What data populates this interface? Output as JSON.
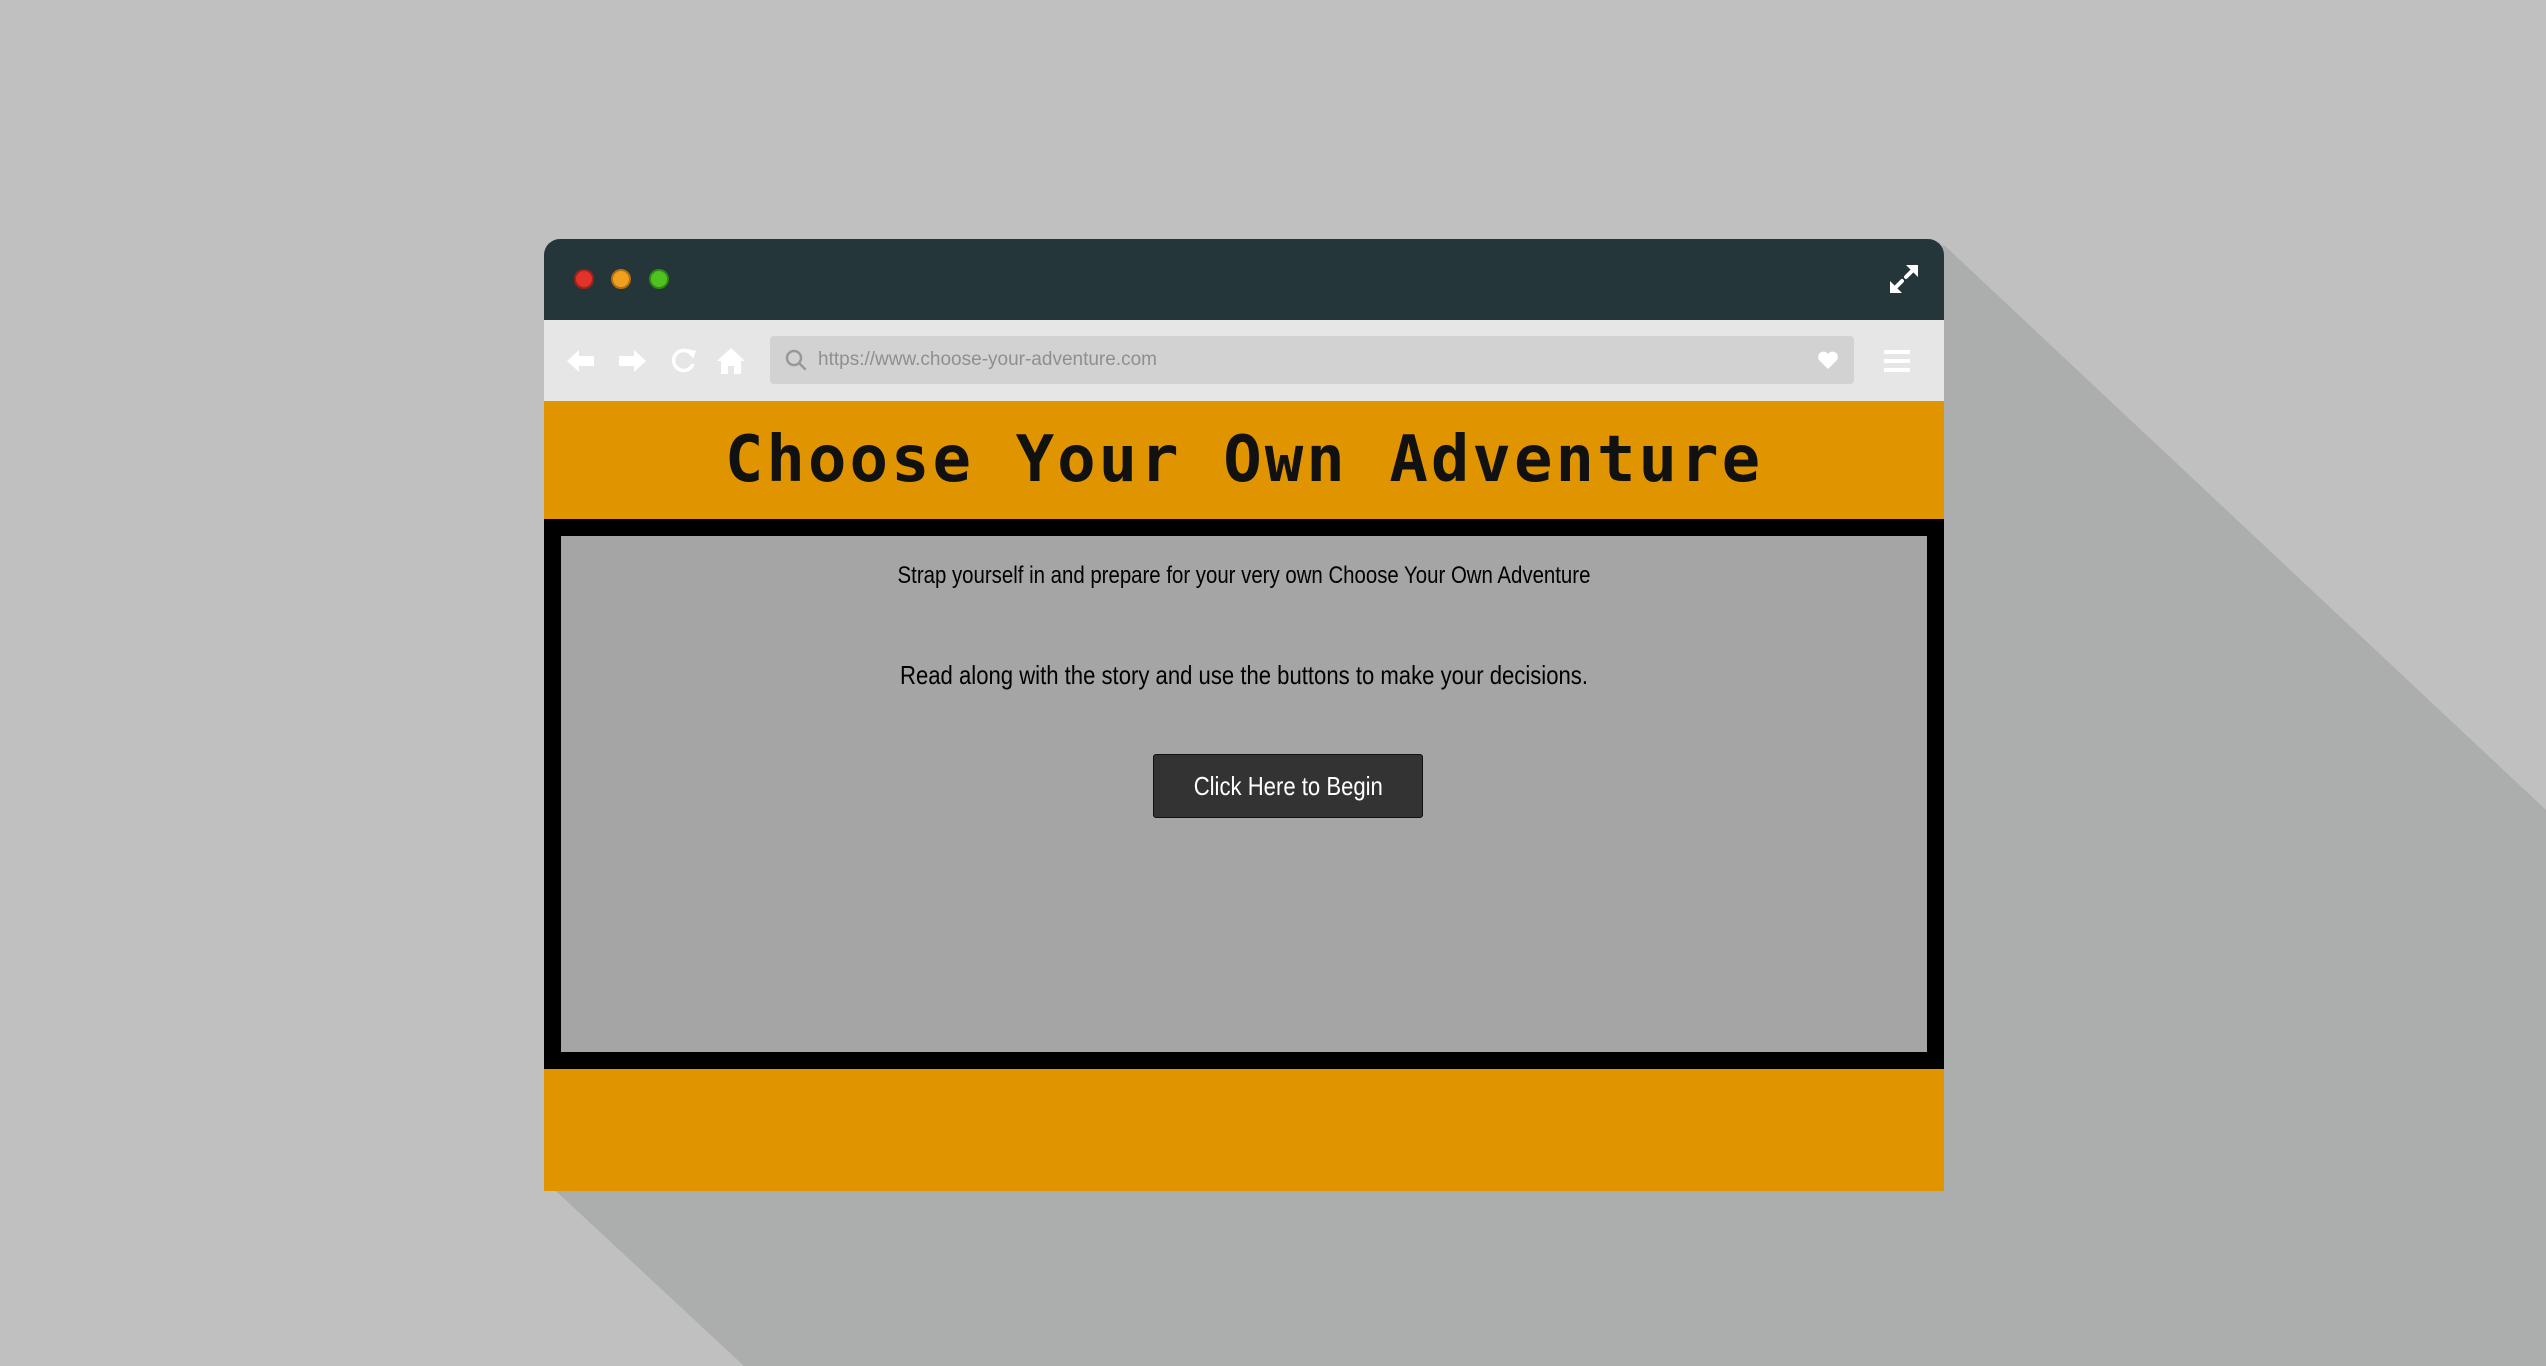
{
  "colors": {
    "background": "#c0c0c0",
    "shadow": "#acadad",
    "titlebar": "#25363b",
    "toolbar": "#e6e6e6",
    "accent_orange": "#df9400",
    "content_frame": "#000000",
    "content_panel": "#a5a5a5",
    "button": "#333333"
  },
  "window_controls": {
    "close": "red-dot",
    "minimize": "yellow-dot",
    "maximize": "green-dot",
    "expand_icon": "expand-icon"
  },
  "toolbar": {
    "icons": [
      "back-arrow-icon",
      "forward-arrow-icon",
      "reload-icon",
      "home-icon",
      "search-icon",
      "heart-icon",
      "hamburger-menu-icon"
    ],
    "url": "https://www.choose-your-adventure.com"
  },
  "page": {
    "title": "Choose Your Own Adventure",
    "intro": "Strap yourself in and prepare for your very own Choose Your Own Adventure",
    "instructions": "Read along with the story and use the buttons to make your decisions.",
    "begin_button": "Click Here to Begin"
  }
}
